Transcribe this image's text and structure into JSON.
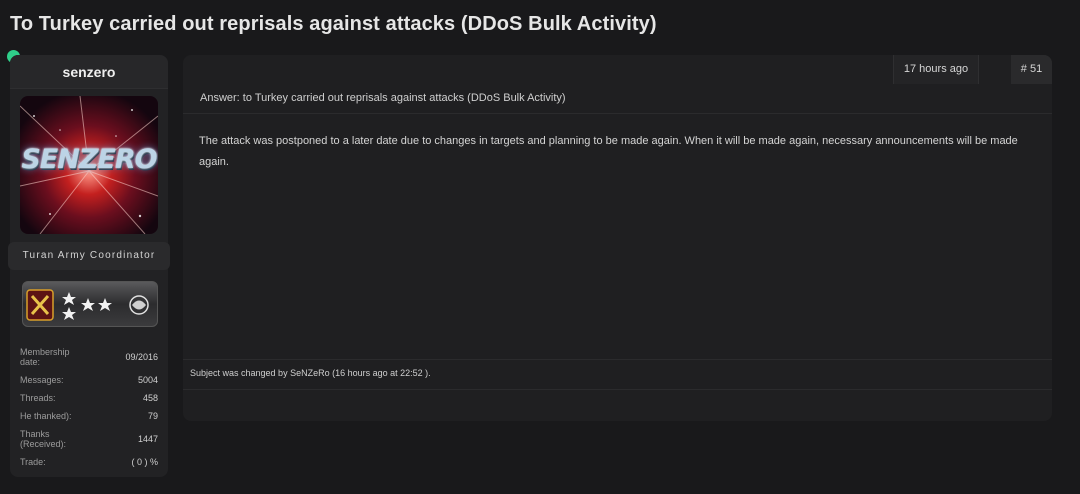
{
  "thread": {
    "title": "To Turkey carried out reprisals against attacks (DDoS Bulk Activity)"
  },
  "user": {
    "online_status": "online",
    "username": "senzero",
    "avatar_text": "SENZERO",
    "role": "Turan Army Coordinator",
    "stats": [
      {
        "label": "Membership date:",
        "value": "09/2016"
      },
      {
        "label": "Messages:",
        "value": "5004"
      },
      {
        "label": "Threads:",
        "value": "458"
      },
      {
        "label": "He thanked):",
        "value": "79"
      },
      {
        "label": "Thanks (Received):",
        "value": "1447"
      },
      {
        "label": "Trade:",
        "value": "( 0 ) %"
      }
    ]
  },
  "post": {
    "time": "17 hours ago",
    "number": "# 51",
    "subject": "Answer: to Turkey carried out reprisals against attacks (DDoS Bulk Activity)",
    "body": "The attack was postponed to a later date due to changes in targets and planning to be made again. When it will be made again, necessary announcements will be made again.",
    "footer": "Subject was changed by SeNZeRo (16 hours ago at 22:52 )."
  },
  "colors": {
    "background": "#19191b",
    "panel": "#1f1f21",
    "online": "#2fcf8a"
  }
}
